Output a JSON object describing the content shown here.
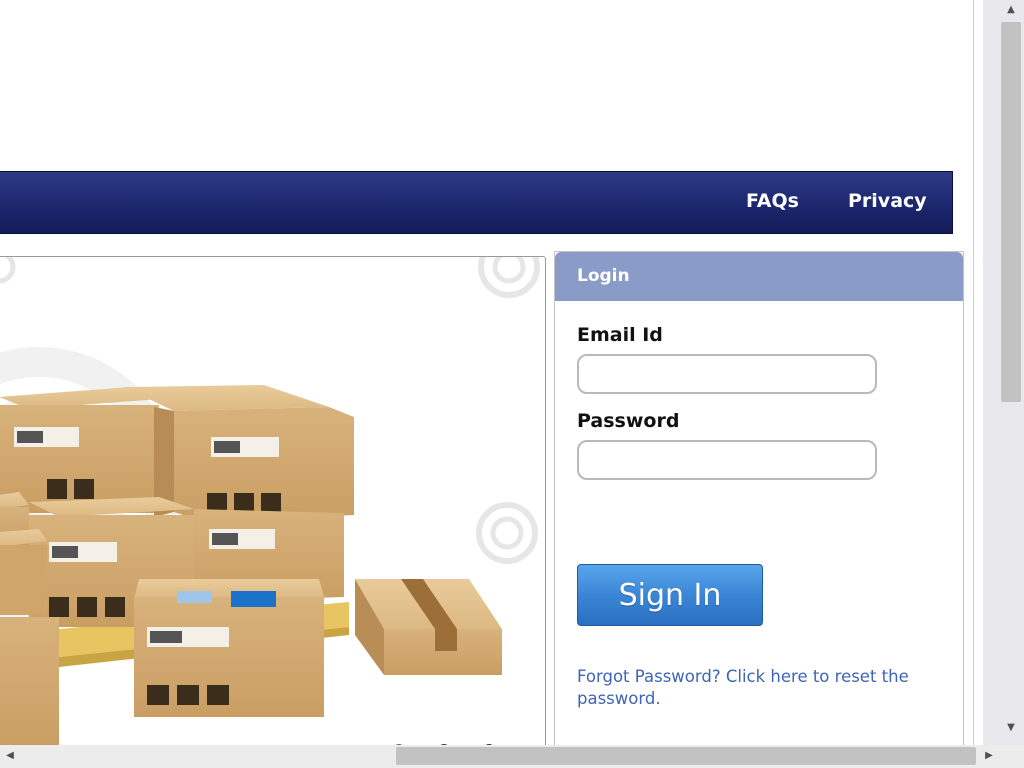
{
  "nav": {
    "links": [
      {
        "label": "FAQs"
      },
      {
        "label": "Privacy"
      }
    ]
  },
  "login": {
    "title": "Login",
    "email_label": "Email Id",
    "email_value": "",
    "password_label": "Password",
    "password_value": "",
    "signin_label": "Sign In",
    "forgot_text": "Forgot Password? Click here to reset the password."
  },
  "banner": {
    "image": "stacked-cardboard-boxes-on-pallet"
  },
  "colors": {
    "navbar": "#1f2a73",
    "login_header": "#8a9bc7",
    "signin_button": "#3b86d6",
    "link": "#3e64b7"
  }
}
